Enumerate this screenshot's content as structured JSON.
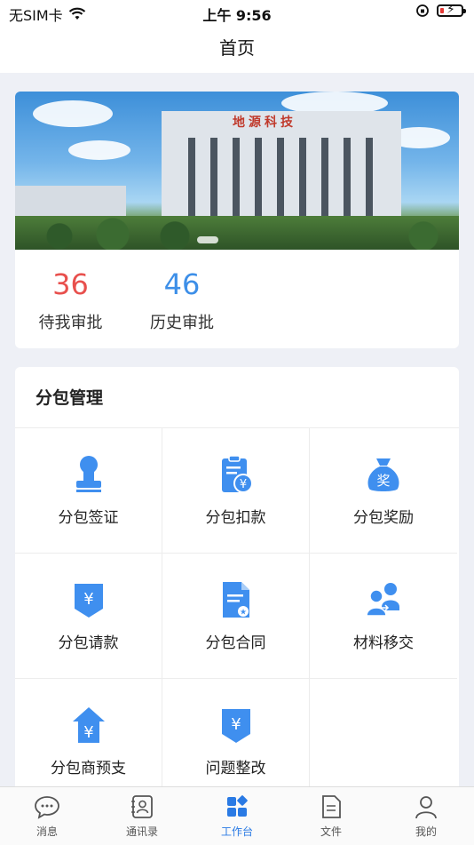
{
  "status_bar": {
    "carrier": "无SIM卡",
    "time": "上午 9:56"
  },
  "nav": {
    "title": "首页"
  },
  "banner": {
    "sign": "地源科技"
  },
  "stats": [
    {
      "value": "36",
      "label": "待我审批"
    },
    {
      "value": "46",
      "label": "历史审批"
    }
  ],
  "section": {
    "title": "分包管理"
  },
  "grid": [
    {
      "label": "分包签证",
      "icon": "stamp-icon"
    },
    {
      "label": "分包扣款",
      "icon": "deduction-doc-icon"
    },
    {
      "label": "分包奖励",
      "icon": "money-bag-icon"
    },
    {
      "label": "分包请款",
      "icon": "yen-request-icon"
    },
    {
      "label": "分包合同",
      "icon": "contract-doc-icon"
    },
    {
      "label": "材料移交",
      "icon": "transfer-people-icon"
    },
    {
      "label": "分包商预支",
      "icon": "yen-house-icon"
    },
    {
      "label": "问题整改",
      "icon": "yen-shield-icon"
    }
  ],
  "tabs": [
    {
      "label": "消息",
      "icon": "chat-bubble-icon"
    },
    {
      "label": "通讯录",
      "icon": "contacts-icon"
    },
    {
      "label": "工作台",
      "icon": "workbench-icon"
    },
    {
      "label": "文件",
      "icon": "file-icon"
    },
    {
      "label": "我的",
      "icon": "person-icon"
    }
  ],
  "colors": {
    "accent": "#2a7ae4",
    "pending": "#e8504d",
    "history": "#3d8fe8",
    "icon_blue": "#3f8fef"
  }
}
